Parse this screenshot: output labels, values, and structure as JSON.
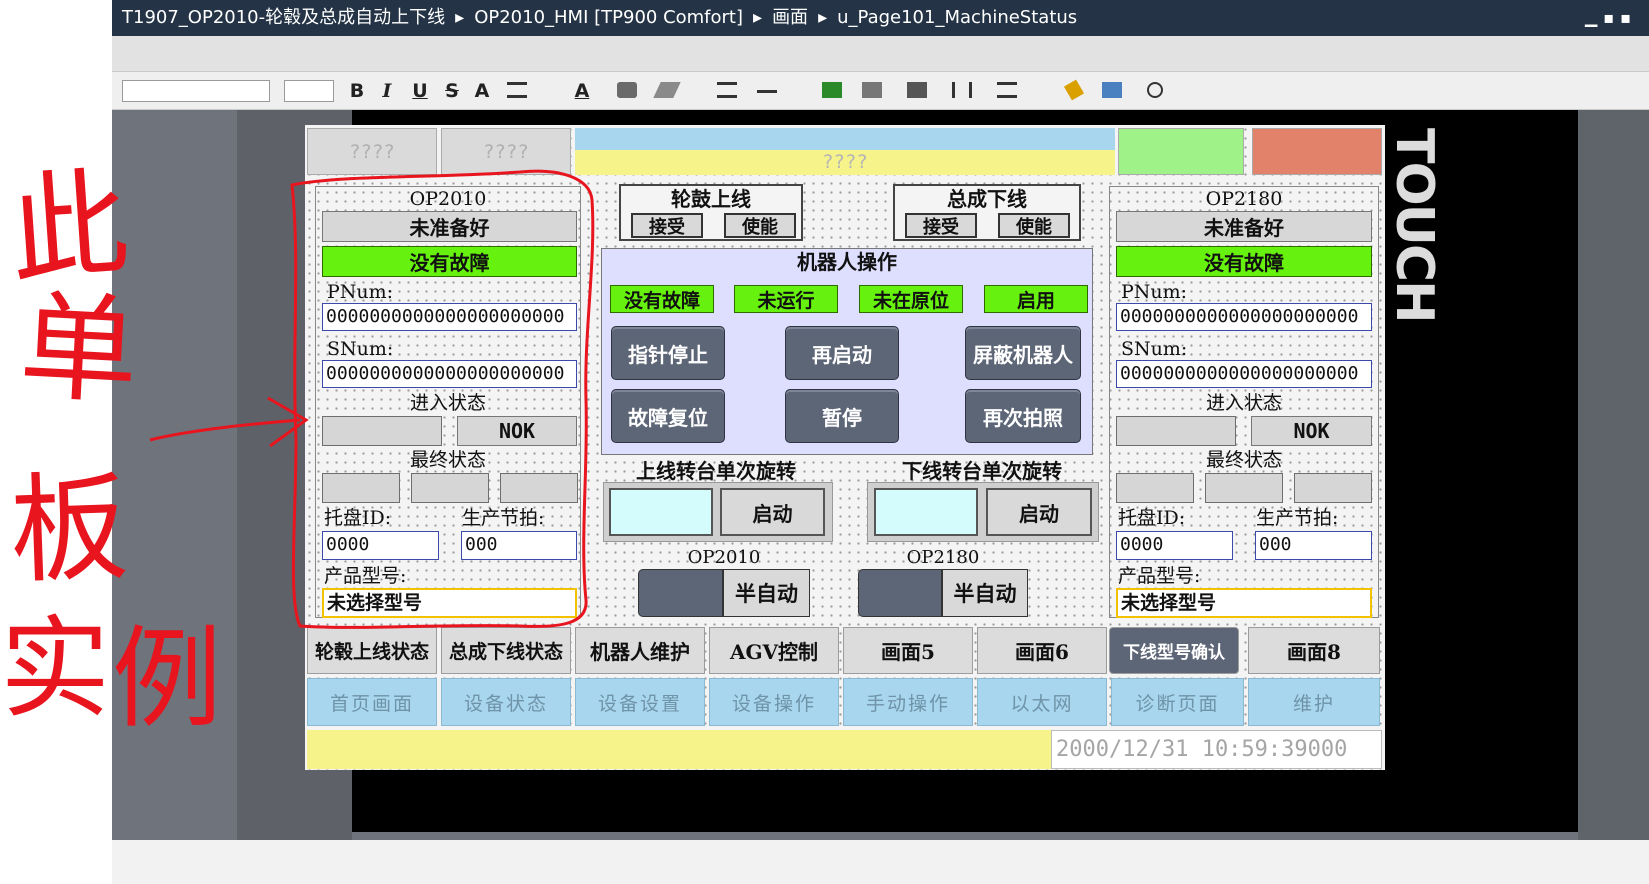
{
  "titlebar": {
    "crumb1": "T1907_OP2010-轮毂及总成自动上下线",
    "crumb2": "OP2010_HMI [TP900 Comfort]",
    "crumb3": "画面",
    "crumb4": "u_Page101_MachineStatus",
    "controls": "▁▪▪"
  },
  "toolbar": {
    "bold": "B",
    "italic": "I",
    "underline": "U",
    "strike": "S",
    "font_grow": "A",
    "text_color": "A"
  },
  "device": {
    "brand": "TOUCH"
  },
  "topbar": {
    "btn1": "????",
    "btn2": "????",
    "center": "????"
  },
  "op2010": {
    "title": "OP2010",
    "ready": "未准备好",
    "fault": "没有故障",
    "pnum_label": "PNum:",
    "pnum": "0000000000000000000000",
    "snum_label": "SNum:",
    "snum": "0000000000000000000000",
    "enter_label": "进入状态",
    "enter_nok": "NOK",
    "final_label": "最终状态",
    "tray_label": "托盘ID:",
    "tray": "0000",
    "beat_label": "生产节拍:",
    "beat": "000",
    "model_label": "产品型号:",
    "model": "未选择型号"
  },
  "op2180": {
    "title": "OP2180",
    "ready": "未准备好",
    "fault": "没有故障",
    "pnum_label": "PNum:",
    "pnum": "0000000000000000000000",
    "snum_label": "SNum:",
    "snum": "0000000000000000000000",
    "enter_label": "进入状态",
    "enter_nok": "NOK",
    "final_label": "最终状态",
    "tray_label": "托盘ID:",
    "tray": "0000",
    "beat_label": "生产节拍:",
    "beat": "000",
    "model_label": "产品型号:",
    "model": "未选择型号"
  },
  "wheel_online": {
    "title": "轮鼓上线",
    "accept": "接受",
    "enable": "使能"
  },
  "assembly_offline": {
    "title": "总成下线",
    "accept": "接受",
    "enable": "使能"
  },
  "robot": {
    "title": "机器人操作",
    "status": [
      "没有故障",
      "未运行",
      "未在原位",
      "启用"
    ],
    "buttons": [
      "指针停止",
      "再启动",
      "屏蔽机器人",
      "故障复位",
      "暂停",
      "再次拍照"
    ]
  },
  "turntable_on": {
    "title": "上线转台单次旋转",
    "start": "启动"
  },
  "turntable_off": {
    "title": "下线转台单次旋转",
    "start": "启动"
  },
  "mode_op2010": {
    "title": "OP2010",
    "mode": "半自动"
  },
  "mode_op2180": {
    "title": "OP2180",
    "mode": "半自动"
  },
  "nav": [
    "轮毂上线状态",
    "总成下线状态",
    "机器人维护",
    "AGV控制",
    "画面5",
    "画面6",
    "下线型号确认",
    "画面8"
  ],
  "bottom_nav": [
    "首页画面",
    "设备状态",
    "设备设置",
    "设备操作",
    "手动操作",
    "以太网",
    "诊断页面",
    "维护"
  ],
  "datetime": "2000/12/31  10:59:39",
  "datetime_suffix": "000",
  "annotation": {
    "text": [
      "此",
      "单",
      "板",
      "实",
      "例"
    ]
  },
  "colors": {
    "status_green": "#66f20e",
    "title_bar": "#243446",
    "annotation_red": "#e8141e",
    "nav_blue": "#a8d6ee",
    "field_border": "#3b4aa8"
  }
}
